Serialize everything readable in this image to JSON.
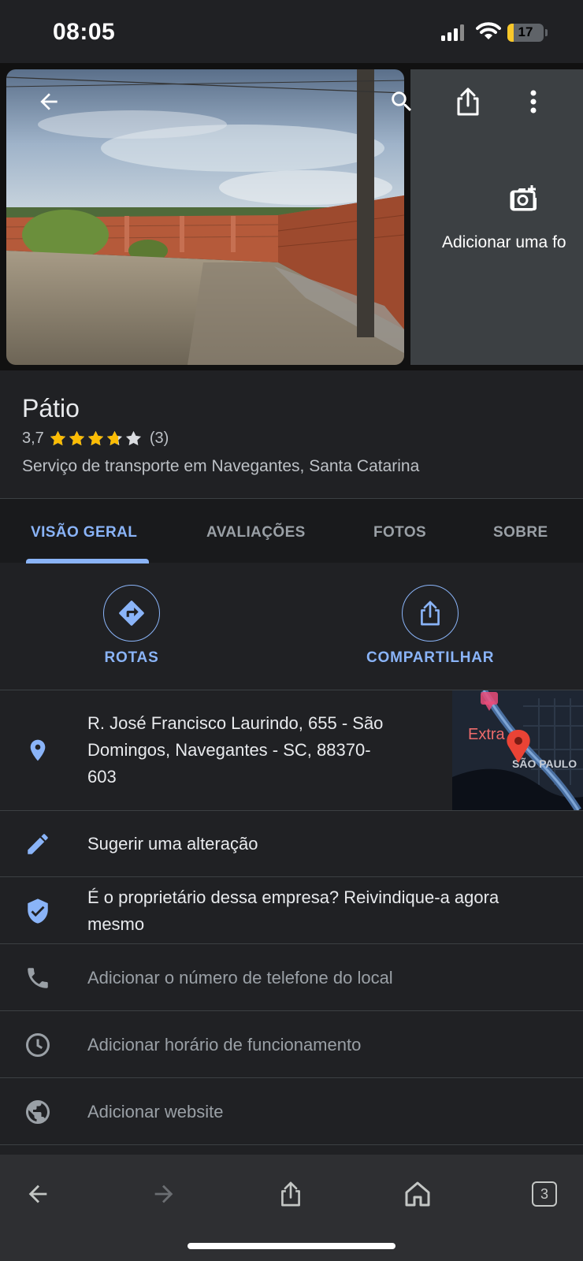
{
  "status_bar": {
    "time": "08:05",
    "battery_level": "17",
    "battery_fraction": 0.17
  },
  "photo": {
    "add_photo_label": "Adicionar uma fo",
    "icons": [
      "back-arrow-icon",
      "search-icon",
      "share-icon",
      "more-vert-icon",
      "add-photo-camera-icon"
    ]
  },
  "place": {
    "title": "Pátio",
    "rating": "3,7",
    "rating_value": 3.7,
    "review_count": "(3)",
    "category": "Serviço de transporte em Navegantes, Santa Catarina"
  },
  "tabs": [
    {
      "label": "VISÃO GERAL",
      "active": true
    },
    {
      "label": "AVALIAÇÕES",
      "active": false
    },
    {
      "label": "FOTOS",
      "active": false
    },
    {
      "label": "SOBRE",
      "active": false
    }
  ],
  "actions": {
    "routes_label": "ROTAS",
    "share_label": "COMPARTILHAR"
  },
  "info": {
    "address_line1": "R. José Francisco Laurindo, 655 - São",
    "address_line2": "Domingos, Navegantes - SC, 88370-",
    "address_line3": "603",
    "suggest_edit": "Sugerir uma alteração",
    "claim_line1": "É o proprietário dessa empresa? Reivindique-a agora",
    "claim_line2": "mesmo",
    "add_phone": "Adicionar o número de telefone do local",
    "add_hours": "Adicionar horário de funcionamento",
    "add_website": "Adicionar website"
  },
  "map": {
    "label_poi": "Extra",
    "label_area": "SÃO PAULO"
  },
  "browser": {
    "tab_count": "3"
  },
  "colors": {
    "background": "#202124",
    "accent": "#8ab4f8",
    "star": "#fbbc04",
    "map_pin": "#ea4335"
  }
}
